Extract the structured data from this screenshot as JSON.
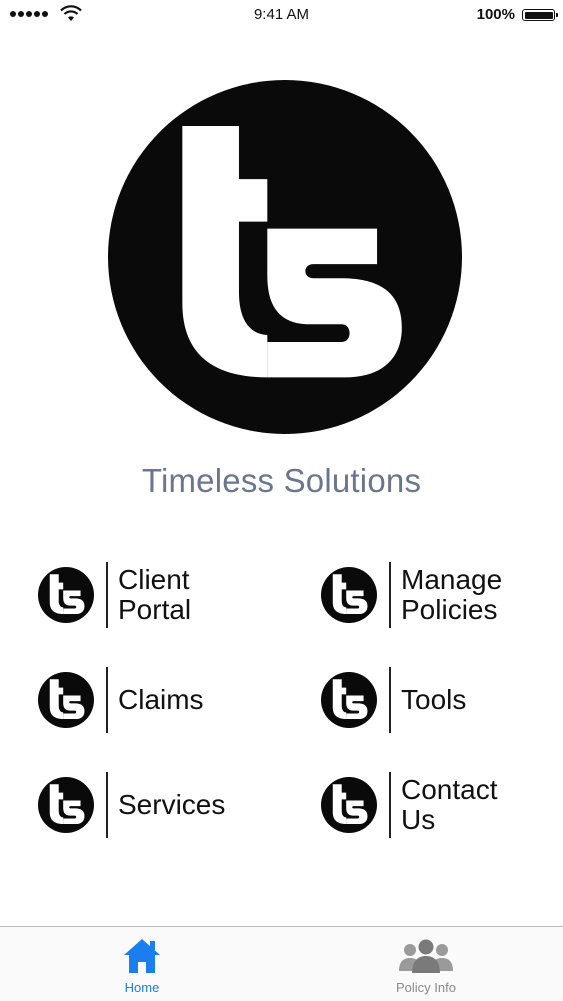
{
  "status_bar": {
    "time": "9:41 AM",
    "battery_percent": "100%",
    "signal_icon": "signal-dots-icon",
    "wifi_icon": "wifi-icon",
    "battery_icon": "battery-icon"
  },
  "brand": {
    "logo_text": "ts",
    "name": "Timeless Solutions",
    "name_color": "#6a7690"
  },
  "menu": [
    {
      "label": "Client\nPortal",
      "icon": "ts-logo-icon"
    },
    {
      "label": "Manage\nPolicies",
      "icon": "ts-logo-icon"
    },
    {
      "label": "Claims",
      "icon": "ts-logo-icon"
    },
    {
      "label": "Tools",
      "icon": "ts-logo-icon"
    },
    {
      "label": "Services",
      "icon": "ts-logo-icon"
    },
    {
      "label": "Contact\nUs",
      "icon": "ts-logo-icon"
    }
  ],
  "tabbar": {
    "tabs": [
      {
        "label": "Home",
        "icon": "home-icon",
        "active": true,
        "color": "#1a7ef0"
      },
      {
        "label": "Policy Info",
        "icon": "people-icon",
        "active": false,
        "color": "#8a8a8a"
      }
    ]
  }
}
